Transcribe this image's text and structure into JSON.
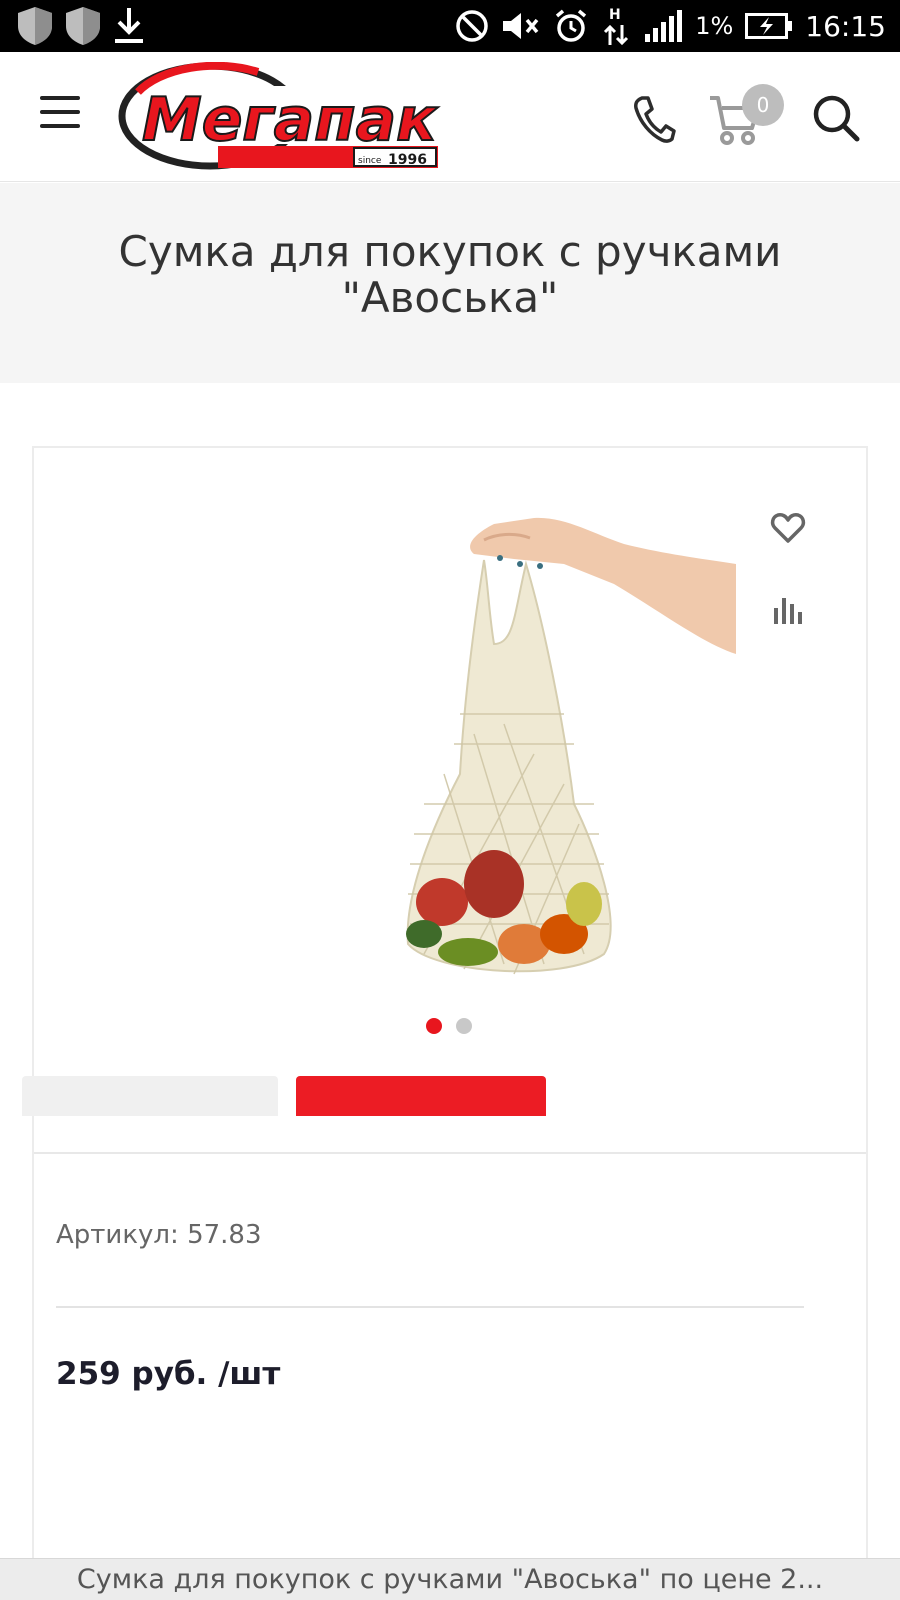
{
  "status_bar": {
    "battery_percent": "1%",
    "time": "16:15",
    "icons": [
      "shield-icon",
      "shield-icon",
      "download-icon",
      "do-not-disturb-icon",
      "mute-icon",
      "alarm-icon",
      "data-h-icon",
      "signal-icon",
      "battery-charging-icon"
    ]
  },
  "header": {
    "logo_text": "Мегапак",
    "logo_since": "since 1996",
    "cart_count": "0",
    "icons": [
      "menu-icon",
      "phone-icon",
      "cart-icon",
      "search-icon"
    ],
    "brand_color": "#e8161e"
  },
  "product": {
    "title": "Сумка для покупок с ручками \"Авоська\"",
    "sku_label": "Артикул: 57.83",
    "price": "259 руб. /шт",
    "gallery": {
      "slides": 2,
      "active_index": 0
    }
  },
  "bottom_bar": {
    "text": "Сумка для покупок с ручками \"Авоська\" по цене 2..."
  }
}
